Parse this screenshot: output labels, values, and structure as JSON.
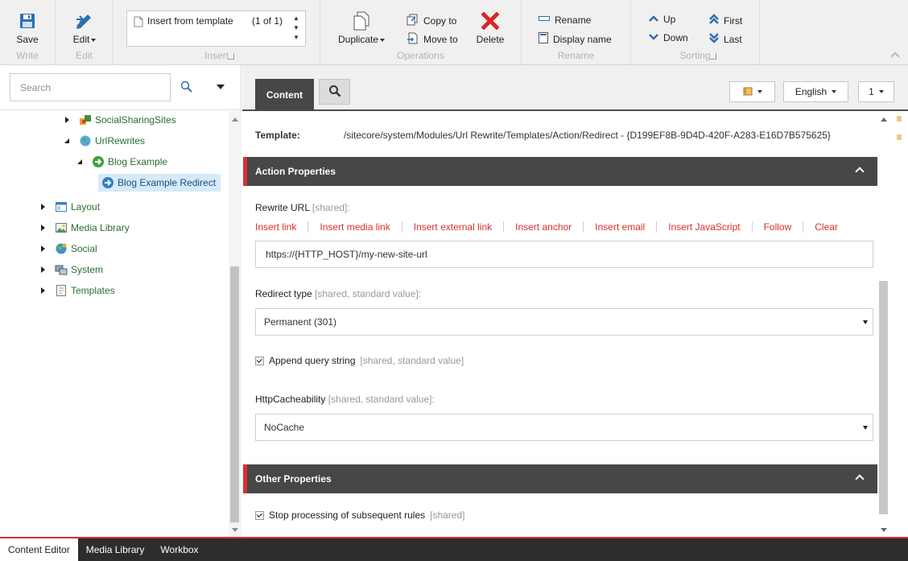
{
  "ribbon": {
    "write": {
      "group_label": "Write",
      "save_label": "Save"
    },
    "edit": {
      "group_label": "Edit",
      "edit_label": "Edit"
    },
    "insert": {
      "group_label": "Insert",
      "template_label": "Insert from template",
      "template_count": "(1 of 1)"
    },
    "operations": {
      "group_label": "Operations",
      "duplicate_label": "Duplicate",
      "copy_to_label": "Copy to",
      "move_to_label": "Move to",
      "delete_label": "Delete"
    },
    "rename": {
      "group_label": "Rename",
      "rename_label": "Rename",
      "display_name_label": "Display name"
    },
    "sorting": {
      "group_label": "Sorting",
      "up_label": "Up",
      "down_label": "Down",
      "first_label": "First",
      "last_label": "Last"
    }
  },
  "search": {
    "placeholder": "Search"
  },
  "tree": {
    "items": [
      {
        "label": "SocialSharingSites",
        "icon": "social-sharing-icon"
      },
      {
        "label": "UrlRewrites",
        "icon": "globe-icon"
      },
      {
        "label": "Blog Example",
        "icon": "green-arrow-icon"
      },
      {
        "label": "Blog Example Redirect",
        "icon": "blue-arrow-icon",
        "selected": true
      },
      {
        "label": "Layout",
        "icon": "layout-icon"
      },
      {
        "label": "Media Library",
        "icon": "media-library-icon"
      },
      {
        "label": "Social",
        "icon": "social-globe-icon"
      },
      {
        "label": "System",
        "icon": "system-icon"
      },
      {
        "label": "Templates",
        "icon": "templates-icon"
      }
    ]
  },
  "content_header": {
    "tab_content": "Content",
    "language": "English",
    "version": "1"
  },
  "form": {
    "template_label": "Template:",
    "template_value": "/sitecore/system/Modules/Url Rewrite/Templates/Action/Redirect - {D199EF8B-9D4D-420F-A283-E16D7B575625}",
    "action_section": "Action Properties",
    "rewrite_url_label": "Rewrite URL",
    "rewrite_url_meta": "[shared]:",
    "links": [
      "Insert link",
      "Insert media link",
      "Insert external link",
      "Insert anchor",
      "Insert email",
      "Insert JavaScript",
      "Follow",
      "Clear"
    ],
    "rewrite_url_value": "https://{HTTP_HOST}/my-new-site-url",
    "redirect_type_label": "Redirect type",
    "redirect_type_meta": "[shared, standard value]:",
    "redirect_type_value": "Permanent (301)",
    "append_query_label": "Append query string",
    "append_query_meta": "[shared, standard value]",
    "http_cache_label": "HttpCacheability",
    "http_cache_meta": "[shared, standard value]:",
    "http_cache_value": "NoCache",
    "other_section": "Other Properties",
    "stop_processing_label": "Stop processing of subsequent rules",
    "stop_processing_meta": "[shared]"
  },
  "bottom_tabs": [
    "Content Editor",
    "Media Library",
    "Workbox"
  ],
  "colors": {
    "accent_red": "#dc2d2d",
    "section_bg": "#474747",
    "tree_text": "#2a6d2f",
    "selection": "#d6eaf8"
  }
}
